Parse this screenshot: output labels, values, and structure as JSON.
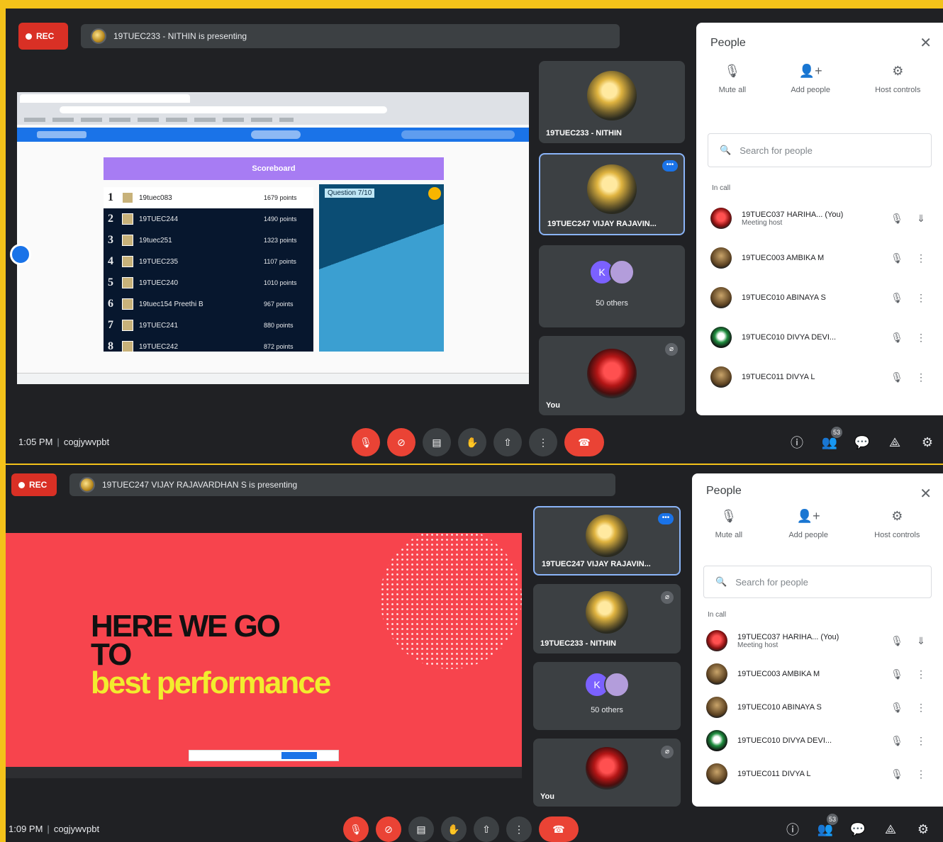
{
  "screens": [
    {
      "rec_label": "REC",
      "presenting_text": "19TUEC233 - NITHIN is presenting",
      "presentation": {
        "slide_header": "Scoreboard",
        "leaderboard": [
          {
            "rank": "1",
            "name": "19tuec083",
            "points": "1679 points"
          },
          {
            "rank": "2",
            "name": "19TUEC244",
            "points": "1490 points"
          },
          {
            "rank": "3",
            "name": "19tuec251",
            "points": "1323 points"
          },
          {
            "rank": "4",
            "name": "19TUEC235",
            "points": "1107 points"
          },
          {
            "rank": "5",
            "name": "19TUEC240",
            "points": "1010 points"
          },
          {
            "rank": "6",
            "name": "19tuec154 Preethi B",
            "points": "967 points"
          },
          {
            "rank": "7",
            "name": "19TUEC241",
            "points": "880 points"
          },
          {
            "rank": "8",
            "name": "19TUEC242",
            "points": "872 points"
          }
        ],
        "question_label": "Question 7/10"
      },
      "tiles": [
        {
          "name": "19TUEC233 - NITHIN",
          "active": false
        },
        {
          "name": "19TUEC247 VIJAY RAJAVIN...",
          "active": true,
          "more": "•••"
        },
        {
          "others_label": "50 others",
          "initial": "K"
        },
        {
          "name": "You",
          "mic": "⌀"
        }
      ],
      "people": {
        "title": "People",
        "actions": [
          {
            "icon": "mute-icon",
            "glyph": "🎙",
            "label": "Mute all"
          },
          {
            "icon": "add-person-icon",
            "glyph": "👤+",
            "label": "Add people"
          },
          {
            "icon": "host-controls-icon",
            "glyph": "⚙",
            "label": "Host controls"
          }
        ],
        "search_placeholder": "Search for people",
        "in_call_label": "In call",
        "participants": [
          {
            "name": "19TUEC037 HARIHA... (You)",
            "sub": "Meeting host",
            "avatar": "red"
          },
          {
            "name": "19TUEC003 AMBIKA M",
            "sub": "",
            "avatar": "brown"
          },
          {
            "name": "19TUEC010 ABINAYA S",
            "sub": "",
            "avatar": "brown"
          },
          {
            "name": "19TUEC010 DIVYA DEVI...",
            "sub": "",
            "avatar": "green"
          },
          {
            "name": "19TUEC011 DIVYA L",
            "sub": "",
            "avatar": "brown"
          }
        ]
      },
      "clock": "1:05 PM",
      "meeting_code": "cogjywvpbt",
      "controls": [
        "mic-off",
        "cam-off",
        "captions",
        "raise-hand",
        "present",
        "more",
        "leave"
      ],
      "participant_count": "53"
    },
    {
      "rec_label": "REC",
      "presenting_text": "19TUEC247 VIJAY RAJAVARDHAN S is presenting",
      "presentation": {
        "title_line1": "HERE WE GO",
        "title_line2": "TO",
        "title_line3": "best performance"
      },
      "tiles": [
        {
          "name": "19TUEC247 VIJAY RAJAVIN...",
          "active": true,
          "more": "•••"
        },
        {
          "name": "19TUEC233 - NITHIN",
          "mic": "⌀"
        },
        {
          "others_label": "50 others",
          "initial": "K"
        },
        {
          "name": "You",
          "mic": "⌀"
        }
      ],
      "people": {
        "title": "People",
        "actions": [
          {
            "icon": "mute-icon",
            "glyph": "🎙",
            "label": "Mute all"
          },
          {
            "icon": "add-person-icon",
            "glyph": "👤+",
            "label": "Add people"
          },
          {
            "icon": "host-controls-icon",
            "glyph": "⚙",
            "label": "Host controls"
          }
        ],
        "search_placeholder": "Search for people",
        "in_call_label": "In call",
        "participants": [
          {
            "name": "19TUEC037 HARIHA... (You)",
            "sub": "Meeting host",
            "avatar": "red"
          },
          {
            "name": "19TUEC003 AMBIKA M",
            "sub": "",
            "avatar": "brown"
          },
          {
            "name": "19TUEC010 ABINAYA S",
            "sub": "",
            "avatar": "brown"
          },
          {
            "name": "19TUEC010 DIVYA DEVI...",
            "sub": "",
            "avatar": "green"
          },
          {
            "name": "19TUEC011 DIVYA L",
            "sub": "",
            "avatar": "brown"
          }
        ]
      },
      "clock": "1:09 PM",
      "meeting_code": "cogjywvpbt",
      "participant_count": "53"
    }
  ],
  "colors": {
    "frame": "#f3c21a",
    "meet_bg": "#202124",
    "tile_bg": "#3c4043",
    "danger": "#ea4335",
    "accent": "#8ab4f8",
    "slide_red": "#f7444d",
    "slide_yellow": "#f2ec2e"
  }
}
